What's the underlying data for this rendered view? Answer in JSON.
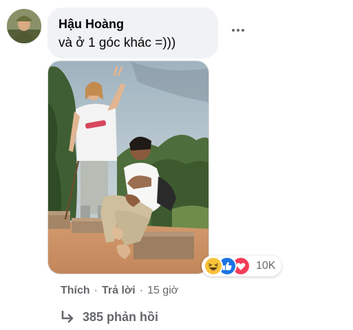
{
  "comment": {
    "author": "Hậu Hoàng",
    "text": "và ở 1 góc khác =)))",
    "attachment": "photo",
    "more_icon": "more-horizontal-icon"
  },
  "reactions": {
    "icons": [
      "haha-reaction-icon",
      "like-reaction-icon",
      "love-reaction-icon"
    ],
    "count": "10K",
    "colors": {
      "haha": "#f7c33b",
      "like": "#1b74e4",
      "love": "#f33e58"
    }
  },
  "actions": {
    "like": "Thích",
    "separator": "·",
    "reply": "Trả lời",
    "time": "15 giờ"
  },
  "replies": {
    "icon": "reply-arrow-icon",
    "label": "385 phản hồi"
  },
  "colors": {
    "bubble": "#f0f2f5",
    "secondary_text": "#65676b",
    "primary_text": "#050505"
  }
}
